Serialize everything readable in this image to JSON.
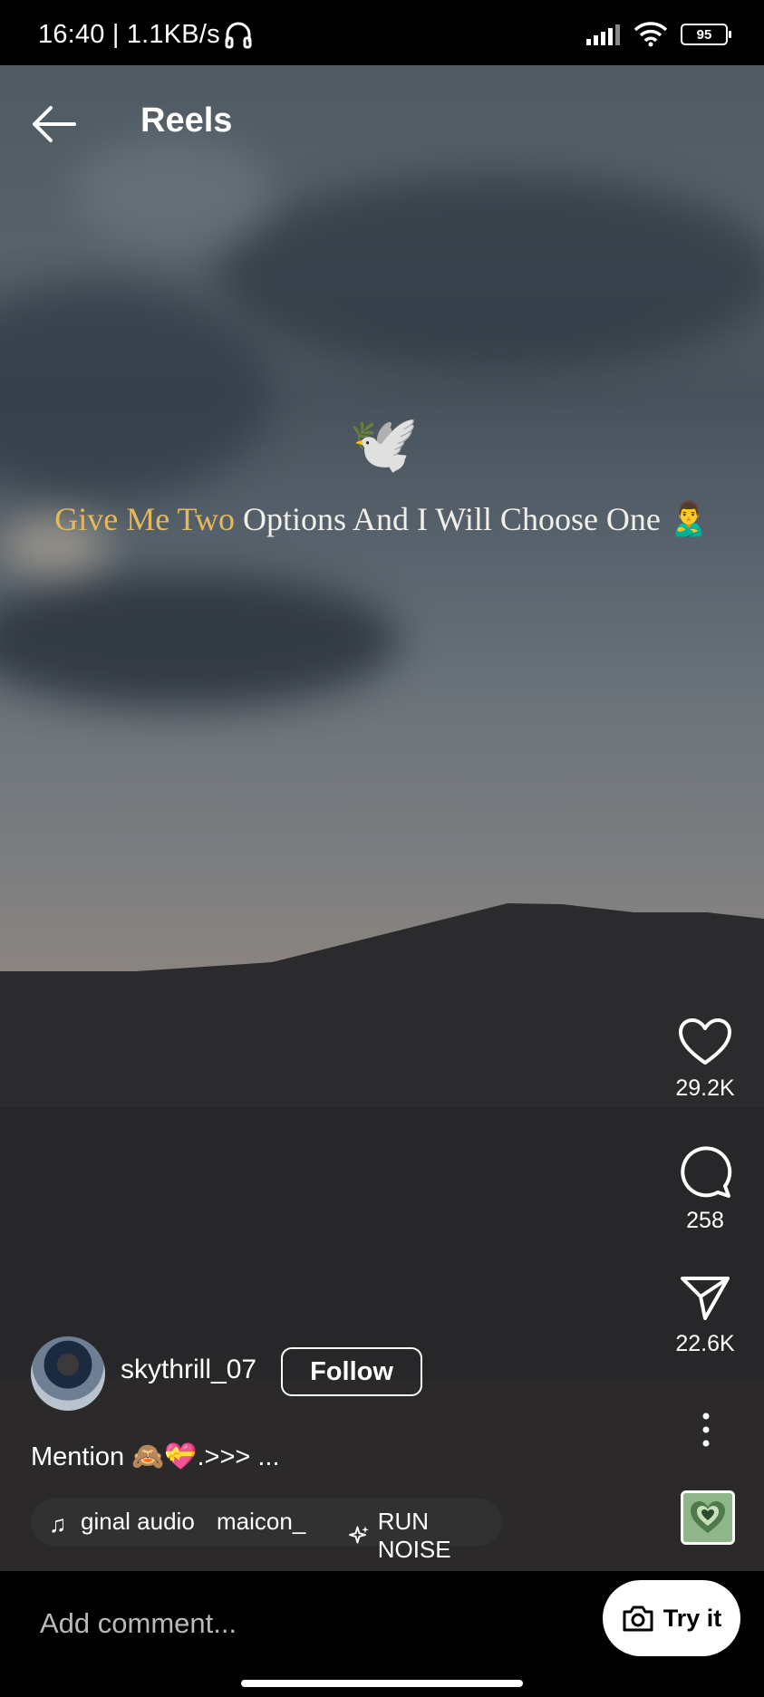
{
  "status_bar": {
    "time_speed": "16:40 | 1.1KB/s",
    "battery": "95"
  },
  "header": {
    "title": "Reels"
  },
  "video": {
    "dove_emoji": "🕊️",
    "overlay_gold": "Give Me Two",
    "overlay_white": " Options And I Will Choose One",
    "overlay_emoji": "🙎‍♂️"
  },
  "actions": {
    "likes": "29.2K",
    "comments": "258",
    "shares": "22.6K"
  },
  "author": {
    "username": "skythrill_07",
    "follow_label": "Follow"
  },
  "caption": "Mention 🙈💝.>>> ...",
  "chips": {
    "audio": "ginal audio",
    "user": "maicon_",
    "effect": "RUN NOISE"
  },
  "comment_bar": {
    "placeholder": "Add comment...",
    "try_label": "Try it"
  },
  "colors": {
    "gold_text": "#e5b95a",
    "background": "#000000"
  }
}
